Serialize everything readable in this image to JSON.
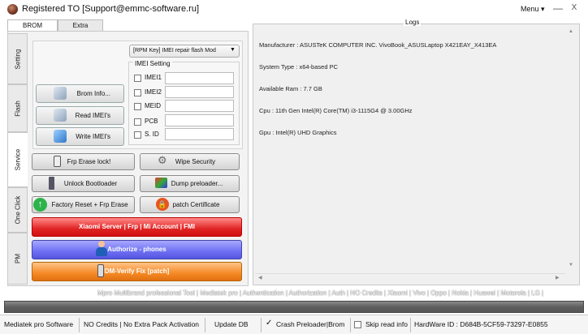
{
  "window": {
    "title": "Registered TO [Support@emmc-software.ru]",
    "menu_label": "Menu ▾",
    "minimize_label": "—",
    "close_label": "X"
  },
  "top_tabs": [
    "BROM",
    "Extra"
  ],
  "side_tabs": [
    "Setting",
    "Flash",
    "Service",
    "One Click",
    "PM"
  ],
  "brom": {
    "select_value": "[RPM Key] IMEI repair flash Mod",
    "imei_setting_label": "IMEI Setting",
    "imei_fields": [
      {
        "label": "IMEI1",
        "value": ""
      },
      {
        "label": "IMEI2",
        "value": ""
      },
      {
        "label": "MEID",
        "value": ""
      },
      {
        "label": "PCB",
        "value": ""
      },
      {
        "label": "S. ID",
        "value": ""
      }
    ],
    "buttons": {
      "brom_info": "Brom Info...",
      "read_imei": "Read IMEI's",
      "write_imei": "Write IMEI's"
    }
  },
  "service_buttons": {
    "frp_erase": "Frp Erase lock!",
    "wipe_security": "Wipe Security",
    "unlock_bootloader": "Unlock Bootloader",
    "dump_preloader": "Dump preloader...",
    "factory_reset": "Factory Reset + Frp Erase",
    "patch_certificate": "patch Certificate",
    "xiaomi": "Xiaomi Server | Frp | Mi Account | FMI",
    "authorize": "Authorize - phones",
    "dm_verify": "DM-Verify Fix [patch]"
  },
  "logs": {
    "title": "Logs",
    "lines": [
      "Manufacturer : ASUSTeK COMPUTER INC. VivoBook_ASUSLaptop X421EAY_X413EA",
      "System Type : x64-based PC",
      "Available Ram : 7.7 GB",
      "Cpu : 11th Gen Intel(R) Core(TM) i3-1115G4 @ 3.00GHz",
      "Gpu : Intel(R) UHD Graphics"
    ]
  },
  "marquee_text": "Mpro Multibrand professional Tool | Mediatek pro | Authentication | Authorization | Auth | NO Credits | Xiaomi | Vivo | Oppo | Nokia | Huawei | Motorola | LG |",
  "status": {
    "software": "Mediatek pro Software",
    "credits": "NO Credits | No Extra Pack Activation",
    "update_db": "Update DB",
    "crash_preloader": "Crash Preloader|Brom",
    "crash_preloader_checked": true,
    "skip_read_info": "Skip read info",
    "skip_read_info_checked": false,
    "hardware_id": "HardWare ID : D684B-5CF59-73297-E0855"
  },
  "colors": {
    "xiaomi_button": "#e02424",
    "authorize_button": "#6d6ff2",
    "dm_verify_button": "#f58a25",
    "progress_bar": "#5f5f5f"
  }
}
